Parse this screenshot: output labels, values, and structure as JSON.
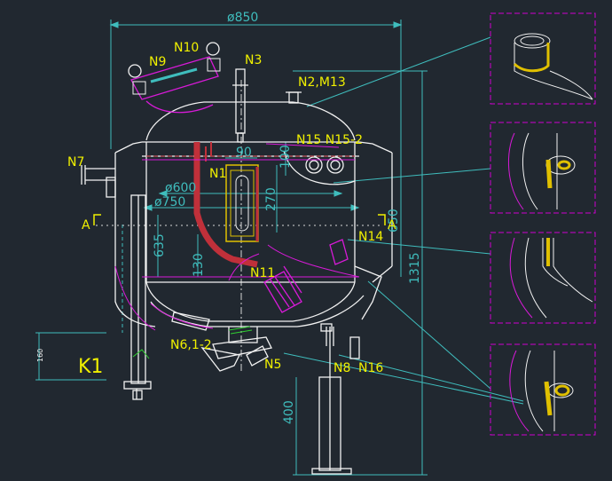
{
  "colors": {
    "background": "#212830",
    "vessel": "#f2f2f2",
    "dimension": "#3fbdbd",
    "label": "#f0f000",
    "weld": "#d81ad8",
    "frame": "#d000d0",
    "jacket": "#c0303a",
    "gasket": "#e0c000"
  },
  "dimensions": {
    "overall_width": "ø850",
    "body_height": "1315",
    "leg_height": "400",
    "inner_dia": "ø600",
    "outer_dia": "ø750",
    "jacket_height": "650",
    "left_elev": "635",
    "left_elev2": "130",
    "top_offset": "100",
    "manhole_width": "90",
    "manhole_height": "270",
    "small_left": "160"
  },
  "labels": {
    "n1": "N1",
    "n2": "N2,M13",
    "n3": "N3",
    "n5": "N5",
    "n6": "N6,1-2",
    "n7": "N7",
    "n8": "N8",
    "n9": "N9",
    "n10": "N10",
    "n11": "N11",
    "n14": "N14",
    "n15": "N15 N15-2",
    "n16": "N16",
    "k1": "K1",
    "section_a_left": "A",
    "section_a_right": "A"
  },
  "details": [
    {
      "name": "nozzle-weld-detail"
    },
    {
      "name": "side-boss-detail"
    },
    {
      "name": "jacket-weld-detail"
    },
    {
      "name": "bottom-boss-detail"
    }
  ]
}
